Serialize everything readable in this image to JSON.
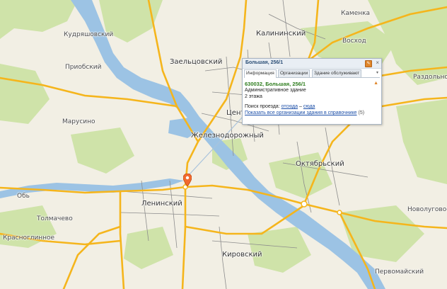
{
  "map": {
    "colors": {
      "land": "#f2efe4",
      "water": "#9cc3e4",
      "park": "#cfe3a9",
      "road_major": "#f5b51c",
      "road_minor": "#8c8c8c",
      "popup_accent": "#2e7d1e",
      "marker": "#f26a2e"
    },
    "labels": {
      "kudryashovsky": "Кудряшовский",
      "prikobsky": "Приобский",
      "kalininsky": "Калининский",
      "kamenka": "Каменка",
      "voskhod": "Восход",
      "zaeltsovsky": "Заельцовский",
      "razdolnoe": "Раздольное",
      "marusino": "Марусино",
      "tsentr": "Цент",
      "zheleznodorozhny": "Железнодорожный",
      "oktyabrsky": "Октябрьский",
      "leninsky": "Ленинский",
      "ob": "Обь",
      "tolmachevo": "Толмачево",
      "novolugovoe": "Новолуговое",
      "krasnoglinnoe": "Красноглинное",
      "kirovsky": "Кировский",
      "pervomaysky": "Первомайский"
    },
    "marker_icon": "location-pin-icon"
  },
  "popup": {
    "title": "Большая, 256/1",
    "tabs": [
      "Информация",
      "Организации",
      "Здание обслуживают"
    ],
    "address": "630032, Большая, 256/1",
    "building_type": "Административное здание",
    "floors": "2 этажа",
    "route_label": "Поиск проезда:",
    "route_from": "отсюда",
    "route_sep": "–",
    "route_to": "сюда",
    "orgs_link": "Показать все организации здания в справочнике",
    "orgs_count": "(5)",
    "icons": {
      "pin": "pin-window-icon",
      "close": "close-icon",
      "warning": "warning-icon",
      "more": "chevron-down-icon"
    }
  }
}
